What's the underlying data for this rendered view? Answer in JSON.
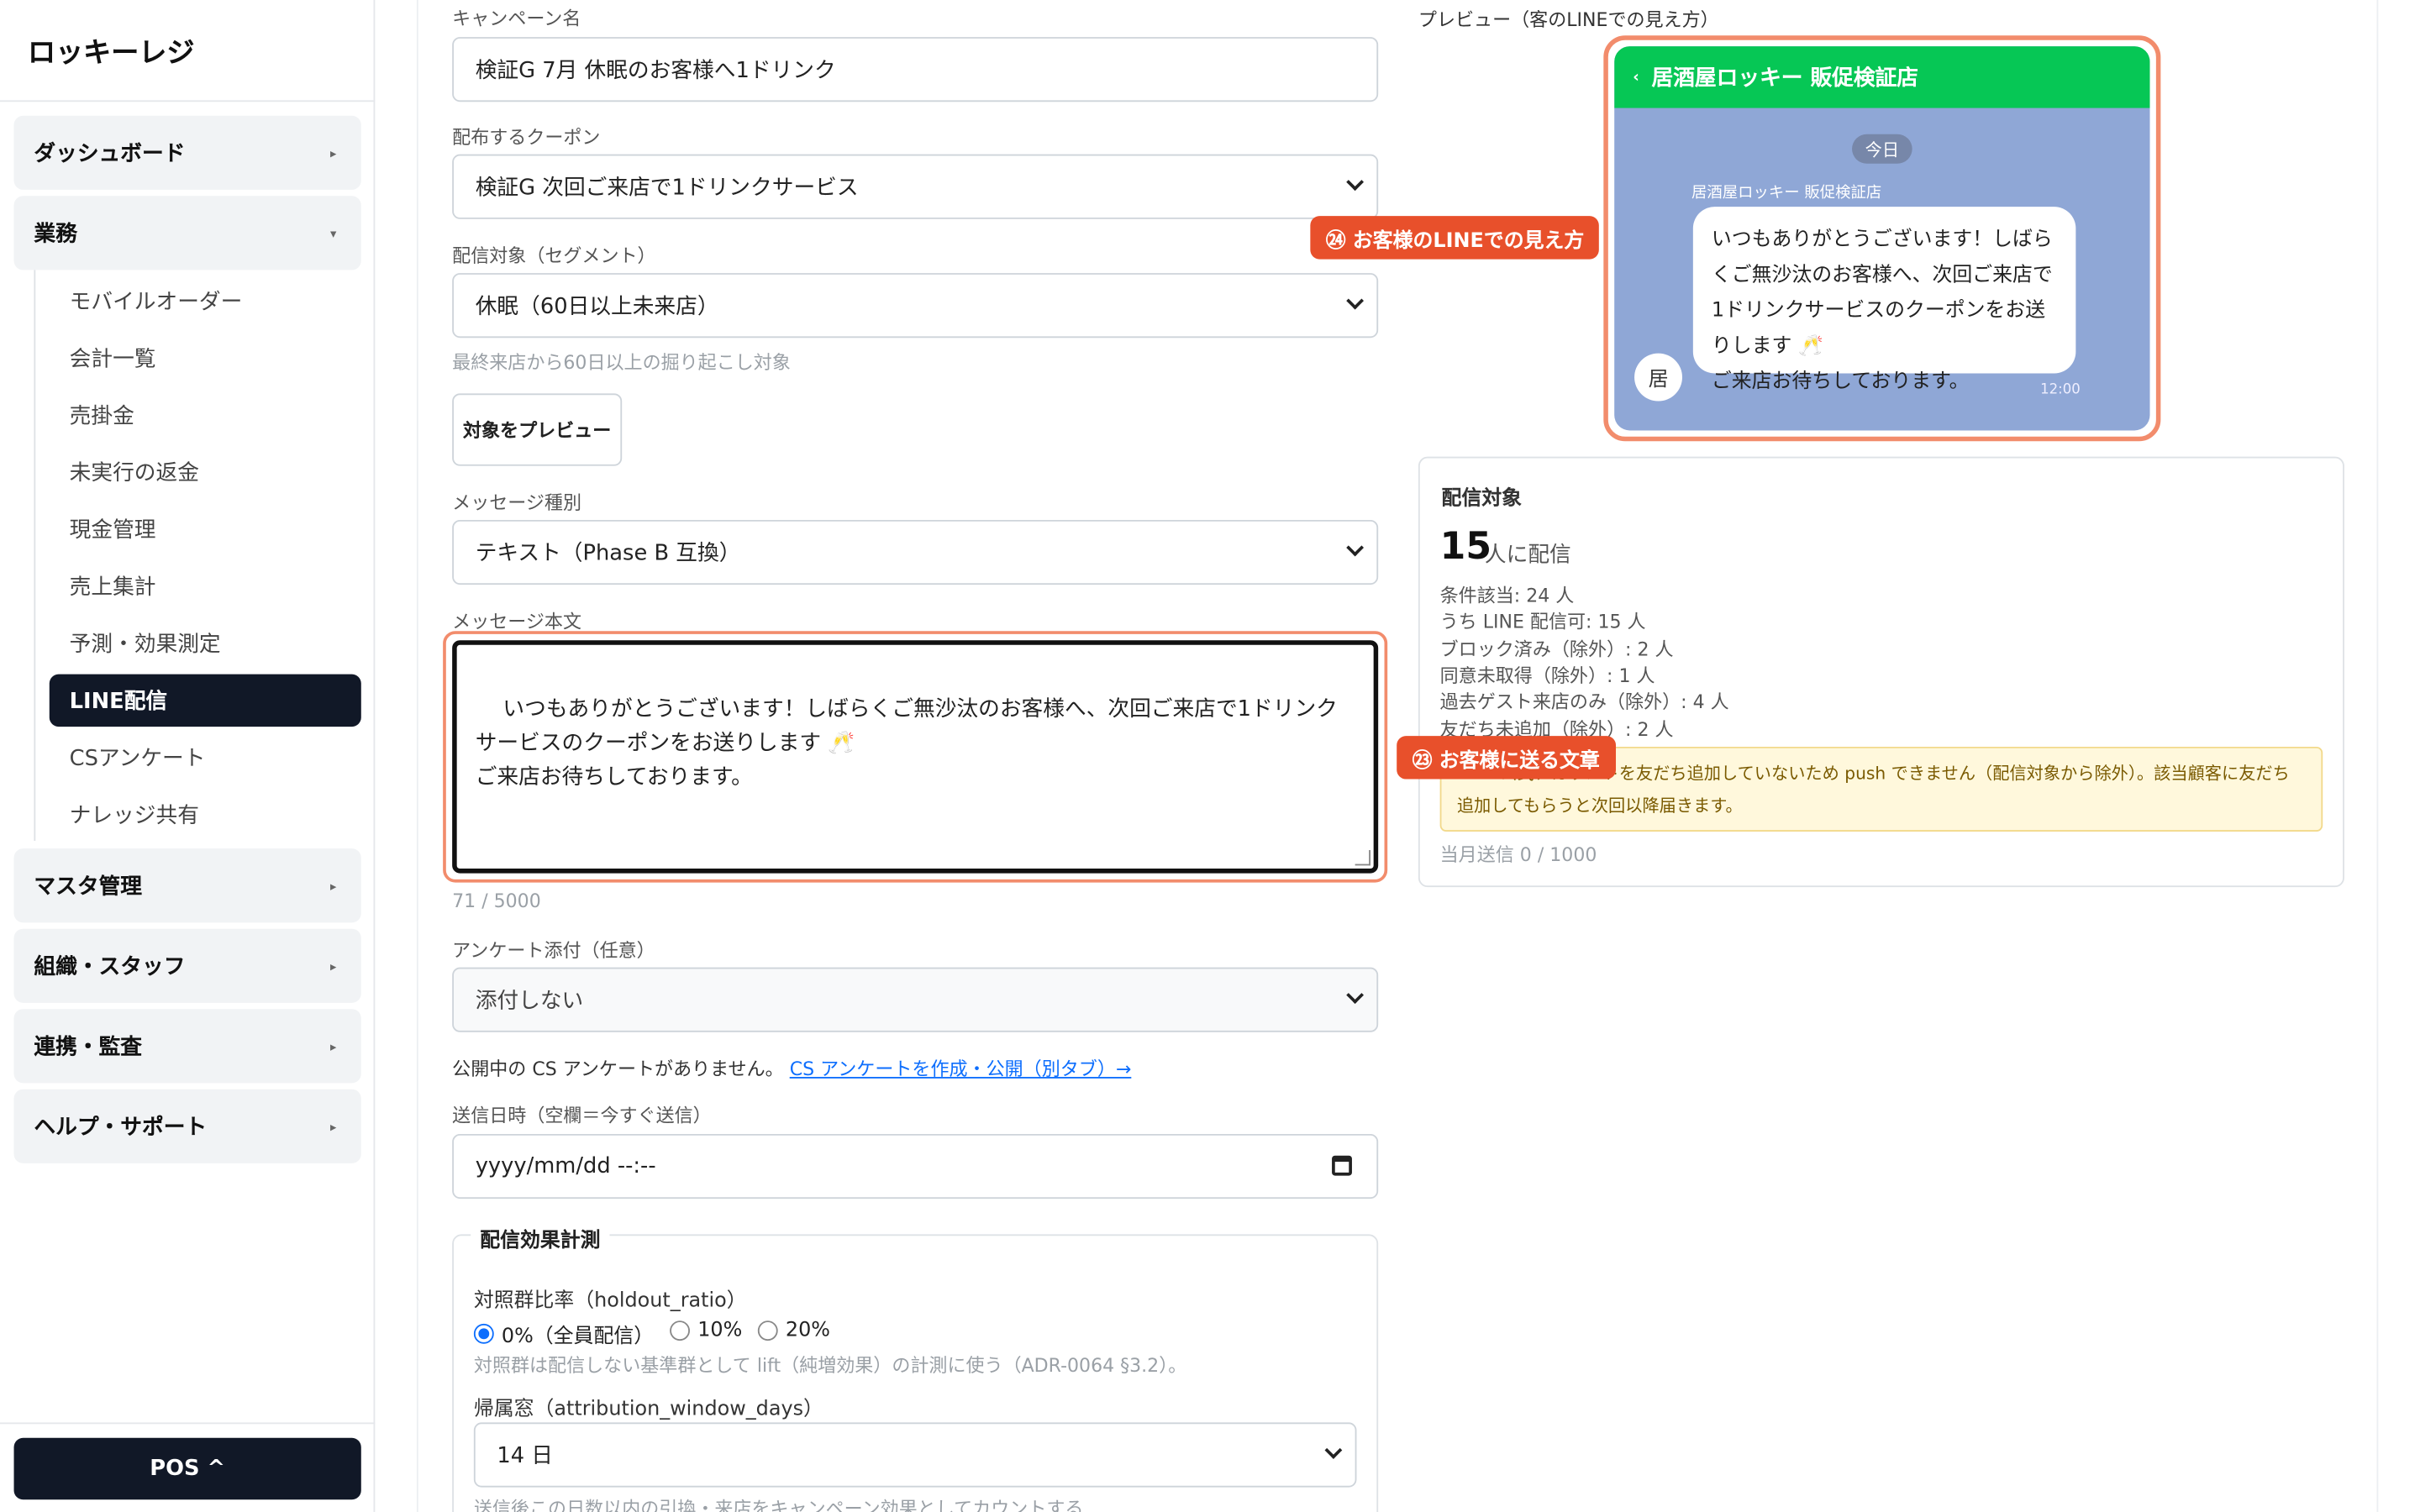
{
  "brand": "ロッキーレジ",
  "sidebar": {
    "groups": [
      {
        "label": "ダッシュボード"
      },
      {
        "label": "業務"
      },
      {
        "label": "マスタ管理"
      },
      {
        "label": "組織・スタッフ"
      },
      {
        "label": "連携・監査"
      },
      {
        "label": "ヘルプ・サポート"
      }
    ],
    "sub_items": [
      "モバイルオーダー",
      "会計一覧",
      "売掛金",
      "未実行の返金",
      "現金管理",
      "売上集計",
      "予測・効果測定",
      "LINE配信",
      "CSアンケート",
      "ナレッジ共有"
    ],
    "pos_button": "POS ^"
  },
  "form": {
    "campaign_label": "キャンペーン名",
    "campaign_value": "検証G 7月 休眠のお客様へ1ドリンク",
    "coupon_label": "配布するクーポン",
    "coupon_value": "検証G 次回ご来店で1ドリンクサービス",
    "segment_label": "配信対象（セグメント）",
    "segment_value": "休眠（60日以上未来店）",
    "segment_hint": "最終来店から60日以上の掘り起こし対象",
    "preview_button": "対象をプレビュー",
    "msgtype_label": "メッセージ種別",
    "msgtype_value": "テキスト（Phase B 互換）",
    "body_label": "メッセージ本文",
    "body_value": "いつもありがとうございます！しばらくご無沙汰のお客様へ、次回ご来店で1ドリンクサービスのクーポンをお送りします 🥂\nご来店お待ちしております。",
    "body_count": "71 / 5000",
    "survey_label": "アンケート添付（任意）",
    "survey_value": "添付しない",
    "survey_note": "公開中の CS アンケートがありません。",
    "survey_link": "CS アンケートを作成・公開（別タブ）→",
    "sendat_label": "送信日時（空欄＝今すぐ送信）",
    "sendat_placeholder": "yyyy/mm/dd --:--",
    "effect_legend": "配信効果計測",
    "holdout_label": "対照群比率（holdout_ratio）",
    "holdout_options": [
      "0%（全員配信）",
      "10%",
      "20%"
    ],
    "holdout_hint": "対照群は配信しない基準群として lift（純増効果）の計測に使う（ADR-0064 §3.2）。",
    "window_label": "帰属窓（attribution_window_days）",
    "window_value": "14 日",
    "window_hint": "送信後この日数以内の引換・来店をキャンペーン効果としてカウントする"
  },
  "preview": {
    "title": "プレビュー（客のLINEでの見え方）",
    "shop_name": "居酒屋ロッキー 販促検証店",
    "today": "今日",
    "sender": "居酒屋ロッキー 販促検証店",
    "bubble": "いつもありがとうございます！しばらくご無沙汰のお客様へ、次回ご来店で1ドリンクサービスのクーポンをお送りします 🥂\nご来店お待ちしております。",
    "avatar": "居",
    "time": "12:00"
  },
  "target": {
    "title": "配信対象",
    "count": "15",
    "count_unit": "人に配信",
    "stats": [
      "条件該当: 24 人",
      "うち LINE 配信可: 15 人",
      "ブロック済み（除外）: 2 人",
      "同意未取得（除外）: 1 人",
      "過去ゲスト来店のみ（除外）: 4 人",
      "友だち未追加（除外）: 2 人"
    ],
    "alert": "LINE 公式アカウントを友だち追加していないため push できません（配信対象から除外）。該当顧客に友だち追加してもらうと次回以降届きます。",
    "monthly": "当月送信 0 / 1000"
  },
  "callouts": {
    "line_view": "㉔ お客様のLINEでの見え方",
    "message": "㉓ お客様に送る文章"
  },
  "colors": {
    "line_green": "#06c755",
    "accent_orange": "#e8502b",
    "nav_dark": "#111827"
  }
}
